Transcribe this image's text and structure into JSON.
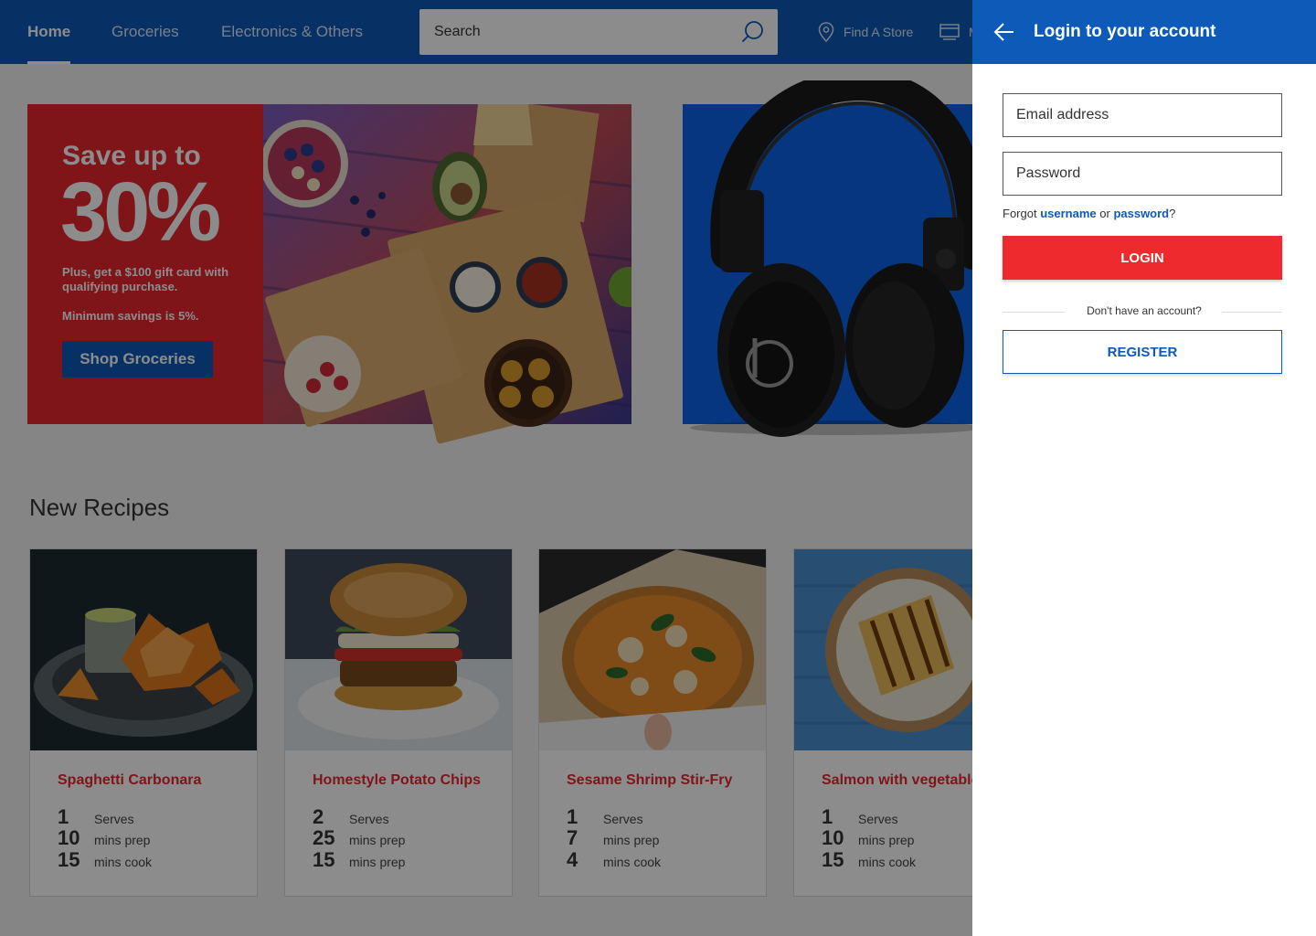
{
  "nav": {
    "tabs": [
      {
        "label": "Home",
        "active": true
      },
      {
        "label": "Groceries",
        "active": false
      },
      {
        "label": "Electronics & Others",
        "active": false
      }
    ],
    "search_placeholder": "Search",
    "find_store": "Find A Store",
    "second_util_partial": "M"
  },
  "hero": {
    "eyebrow": "Save up to",
    "percent": "30%",
    "description": "Plus, get a $100 gift card with qualifying purchase.",
    "minimum": "Minimum savings is 5%.",
    "cta": "Shop Groceries"
  },
  "recipes": {
    "title": "New Recipes",
    "items": [
      {
        "name": "Spaghetti Carbonara",
        "stats": [
          {
            "num": "1",
            "label": "Serves"
          },
          {
            "num": "10",
            "label": "mins prep"
          },
          {
            "num": "15",
            "label": "mins cook"
          }
        ]
      },
      {
        "name": "Homestyle Potato Chips",
        "stats": [
          {
            "num": "2",
            "label": "Serves"
          },
          {
            "num": "25",
            "label": "mins prep"
          },
          {
            "num": "15",
            "label": "mins prep"
          }
        ]
      },
      {
        "name": "Sesame Shrimp Stir-Fry",
        "stats": [
          {
            "num": "1",
            "label": "Serves"
          },
          {
            "num": "7",
            "label": "mins prep"
          },
          {
            "num": "4",
            "label": "mins cook"
          }
        ]
      },
      {
        "name": "Salmon with vegetables",
        "stats": [
          {
            "num": "1",
            "label": "Serves"
          },
          {
            "num": "10",
            "label": "mins prep"
          },
          {
            "num": "15",
            "label": "mins cook"
          }
        ]
      }
    ]
  },
  "login": {
    "title": "Login to your account",
    "email_placeholder": "Email address",
    "password_placeholder": "Password",
    "forgot_prefix": "Forgot",
    "forgot_username": "username",
    "forgot_or": "or",
    "forgot_password": "password",
    "forgot_suffix": "?",
    "login_label": "LOGIN",
    "no_account": "Don't have an account?",
    "register_label": "REGISTER"
  },
  "colors": {
    "brand_blue": "#0d5ab9",
    "accent_red": "#e8272c",
    "audio_blue": "#0a63e8"
  }
}
